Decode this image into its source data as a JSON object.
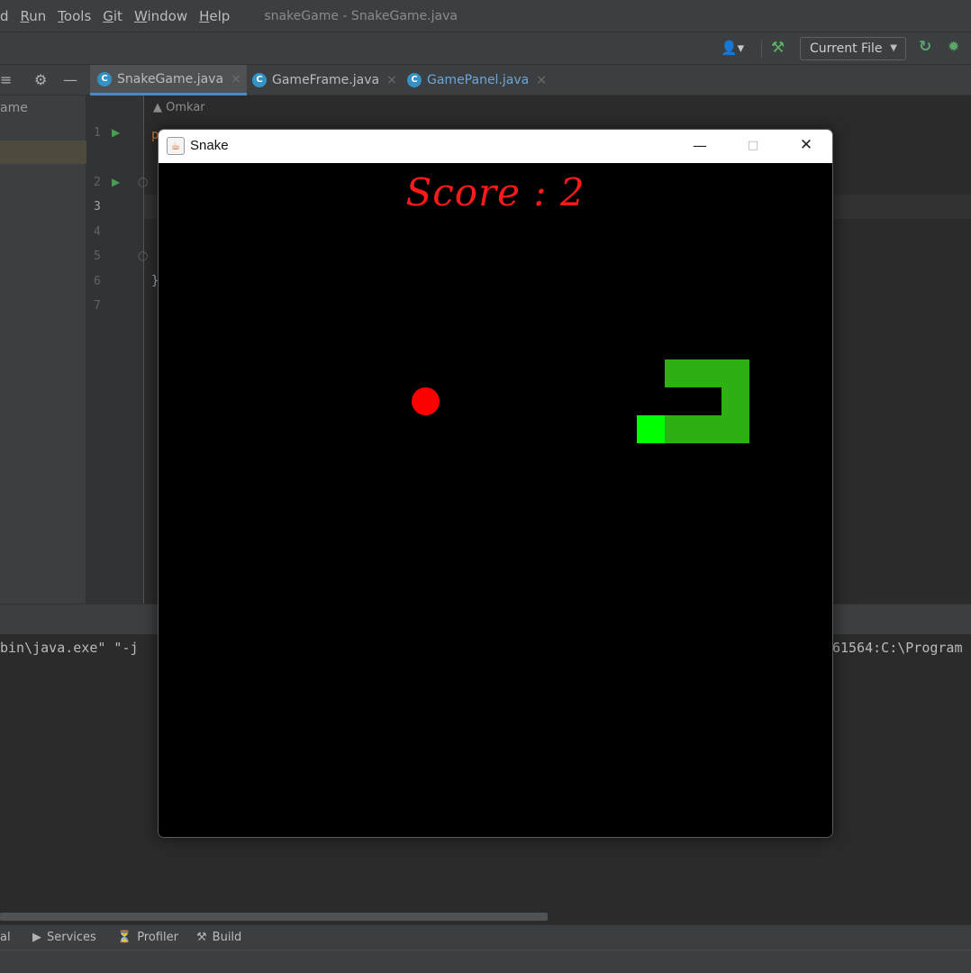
{
  "menubar": {
    "items": [
      {
        "label": "d",
        "mnemonic": ""
      },
      {
        "label": "Run"
      },
      {
        "label": "Tools"
      },
      {
        "label": "Git"
      },
      {
        "label": "Window"
      },
      {
        "label": "Help"
      }
    ],
    "project_title": "snakeGame - SnakeGame.java"
  },
  "toolbar": {
    "run_config": "Current File",
    "icons": [
      "user-icon",
      "hammer-icon",
      "rerun-icon",
      "debug-icon"
    ]
  },
  "tabs": [
    {
      "label": "SnakeGame.java",
      "active": true
    },
    {
      "label": "GameFrame.java",
      "active": false
    },
    {
      "label": "GamePanel.java",
      "active": false
    }
  ],
  "project_panel": {
    "label": "ame"
  },
  "editor": {
    "author": "Omkar",
    "line_numbers": [
      "1",
      "2",
      "3",
      "4",
      "5",
      "6",
      "7"
    ],
    "current_line": "3",
    "code_fragment": "p",
    "closing_brace": "}"
  },
  "console": {
    "left_text": "bin\\java.exe\" \"-j",
    "right_text": "61564:C:\\Program"
  },
  "tool_window_bar": {
    "items": [
      {
        "label": "al"
      },
      {
        "label": "Services"
      },
      {
        "label": "Profiler"
      },
      {
        "label": "Build"
      }
    ]
  },
  "snake_window": {
    "title": "Snake",
    "score_text": "Score : 2",
    "colors": {
      "apple": "#ff0000",
      "snake_body": "#2eaf12",
      "snake_head": "#00ff00",
      "score": "#ff1a1a",
      "background": "#000000"
    }
  }
}
